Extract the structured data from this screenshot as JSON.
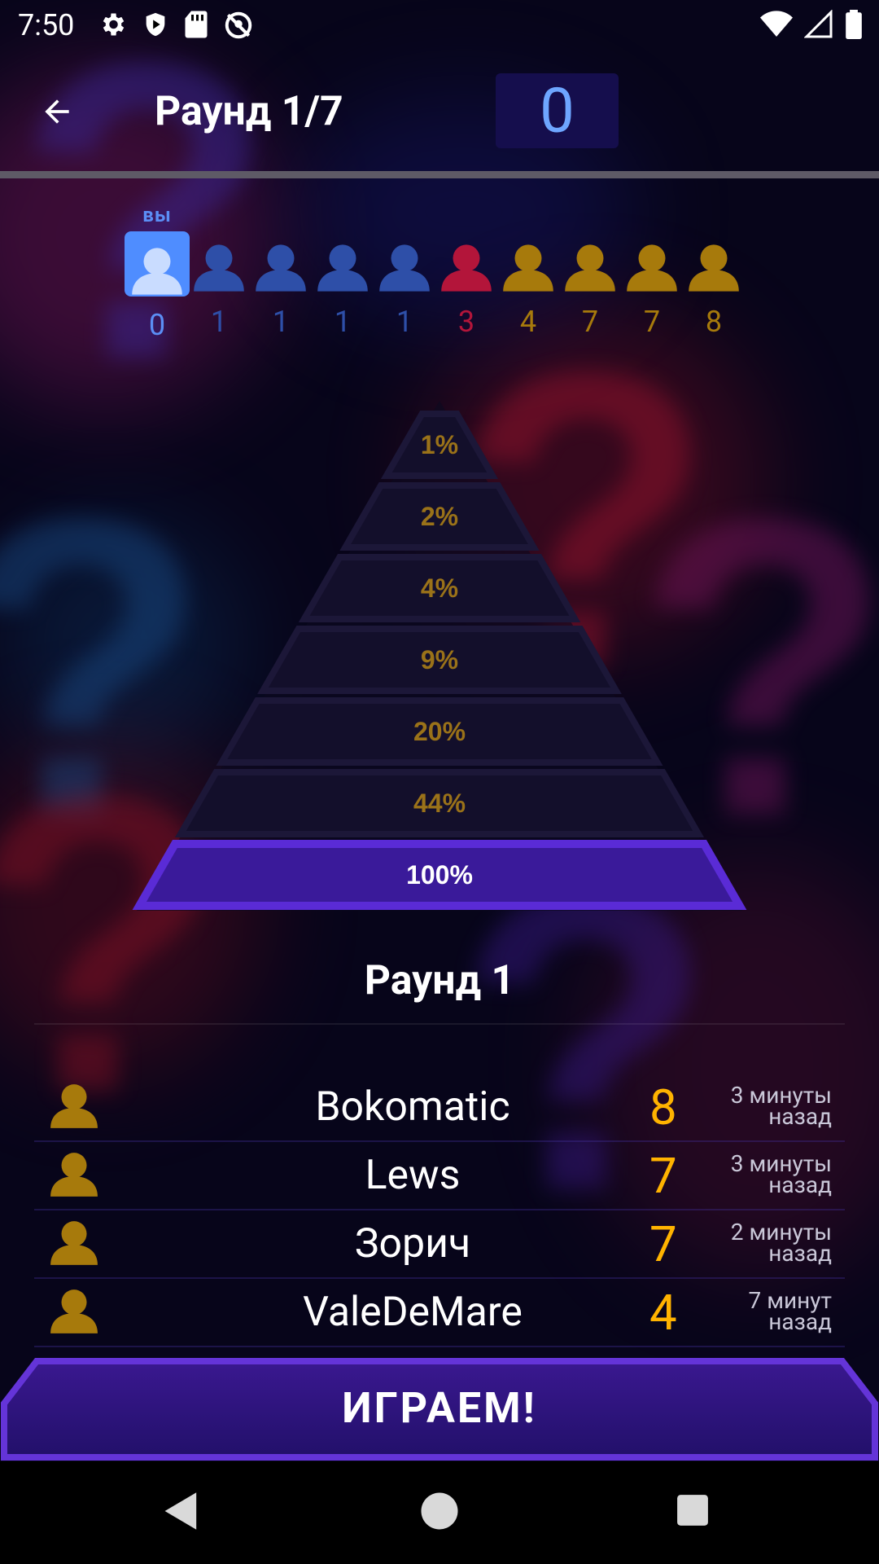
{
  "status_bar": {
    "time": "7:50",
    "left_icons": [
      "settings-icon",
      "shield-icon",
      "sd-card-icon",
      "no-location-icon"
    ],
    "right_icons": [
      "wifi-icon",
      "cellular-icon",
      "battery-icon"
    ]
  },
  "header": {
    "round_title": "Раунд 1/7",
    "score": "0"
  },
  "players": {
    "you_label": "вы",
    "list": [
      {
        "value": "0",
        "color": "#4f8dff",
        "me": true
      },
      {
        "value": "1",
        "color": "#2e4fa8"
      },
      {
        "value": "1",
        "color": "#2e4fa8"
      },
      {
        "value": "1",
        "color": "#2e4fa8"
      },
      {
        "value": "1",
        "color": "#2e4fa8"
      },
      {
        "value": "3",
        "color": "#b3153a"
      },
      {
        "value": "4",
        "color": "#a77a0c"
      },
      {
        "value": "7",
        "color": "#a77a0c"
      },
      {
        "value": "7",
        "color": "#a77a0c"
      },
      {
        "value": "8",
        "color": "#a77a0c"
      }
    ]
  },
  "pyramid": {
    "levels": [
      "1%",
      "2%",
      "4%",
      "9%",
      "20%",
      "44%",
      "100%"
    ],
    "active_level": "100%"
  },
  "round_label": "Раунд 1",
  "leaderboard": [
    {
      "name": "Bokomatic",
      "score": "8",
      "time_line1": "3 минуты",
      "time_line2": "назад"
    },
    {
      "name": "Lews",
      "score": "7",
      "time_line1": "3 минуты",
      "time_line2": "назад"
    },
    {
      "name": "Зорич",
      "score": "7",
      "time_line1": "2 минуты",
      "time_line2": "назад"
    },
    {
      "name": "ValeDeMare",
      "score": "4",
      "time_line1": "7 минут",
      "time_line2": "назад"
    }
  ],
  "play_button": "ИГРАЕМ!",
  "colors": {
    "background": "#07051a",
    "accent_purple": "#5a2bd6",
    "score_gold": "#ffb300",
    "pyramid_text": "#9a7219",
    "score_box": "#150e4d",
    "score_text": "#6ea6ff"
  },
  "nav_bar": [
    "back-triangle-icon",
    "home-circle-icon",
    "recents-square-icon"
  ]
}
